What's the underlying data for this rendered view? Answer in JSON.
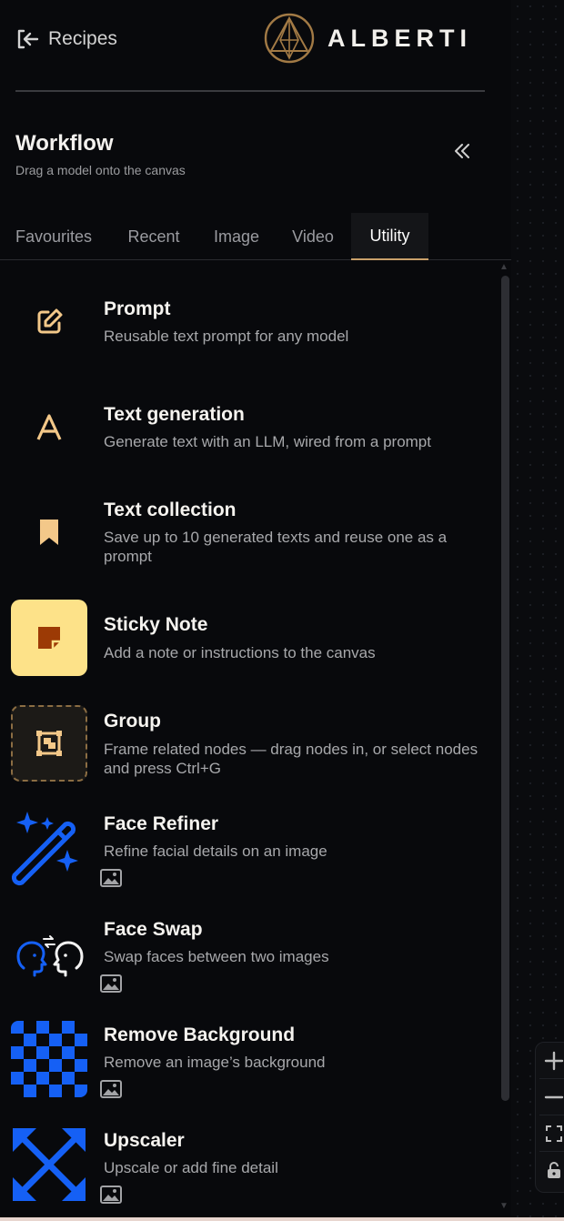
{
  "header": {
    "back_label": "Recipes",
    "logo_text": "ALBERTI"
  },
  "workflow": {
    "title": "Workflow",
    "subtitle": "Drag a model onto the canvas"
  },
  "tabs": [
    {
      "label": "Favourites",
      "active": false
    },
    {
      "label": "Recent",
      "active": false
    },
    {
      "label": "Image",
      "active": false
    },
    {
      "label": "Video",
      "active": false
    },
    {
      "label": "Utility",
      "active": true
    }
  ],
  "items": [
    {
      "title": "Prompt",
      "desc": "Reusable text prompt for any model",
      "icon": "edit-icon"
    },
    {
      "title": "Text generation",
      "desc": "Generate text with an LLM, wired from a prompt",
      "icon": "letter-a-icon"
    },
    {
      "title": "Text collection",
      "desc": "Save up to 10 generated texts and reuse one as a prompt",
      "icon": "bookmark-icon"
    },
    {
      "title": "Sticky Note",
      "desc": "Add a note or instructions to the canvas",
      "icon": "sticky-note-icon"
    },
    {
      "title": "Group",
      "desc": "Frame related nodes — drag nodes in, or select nodes and press Ctrl+G",
      "icon": "group-frame-icon"
    },
    {
      "title": "Face Refiner",
      "desc": "Refine facial details on an image",
      "icon": "magic-wand-icon",
      "input": "image-icon"
    },
    {
      "title": "Face Swap",
      "desc": "Swap faces between two images",
      "icon": "face-swap-icon",
      "input": "image-icon"
    },
    {
      "title": "Remove Background",
      "desc": "Remove an image’s background",
      "icon": "checkerboard-icon",
      "input": "image-icon"
    },
    {
      "title": "Upscaler",
      "desc": "Upscale or add fine detail",
      "icon": "expand-arrows-icon",
      "input": "image-icon"
    }
  ],
  "canvas_controls": [
    "zoom-in-icon",
    "zoom-out-icon",
    "fit-view-icon",
    "lock-icon"
  ],
  "colors": {
    "accent_gold": "#c9a06a",
    "icon_gold": "#f3c889",
    "icon_blue": "#1560f5",
    "sticky_yellow": "#fde289",
    "background": "#08090c"
  }
}
